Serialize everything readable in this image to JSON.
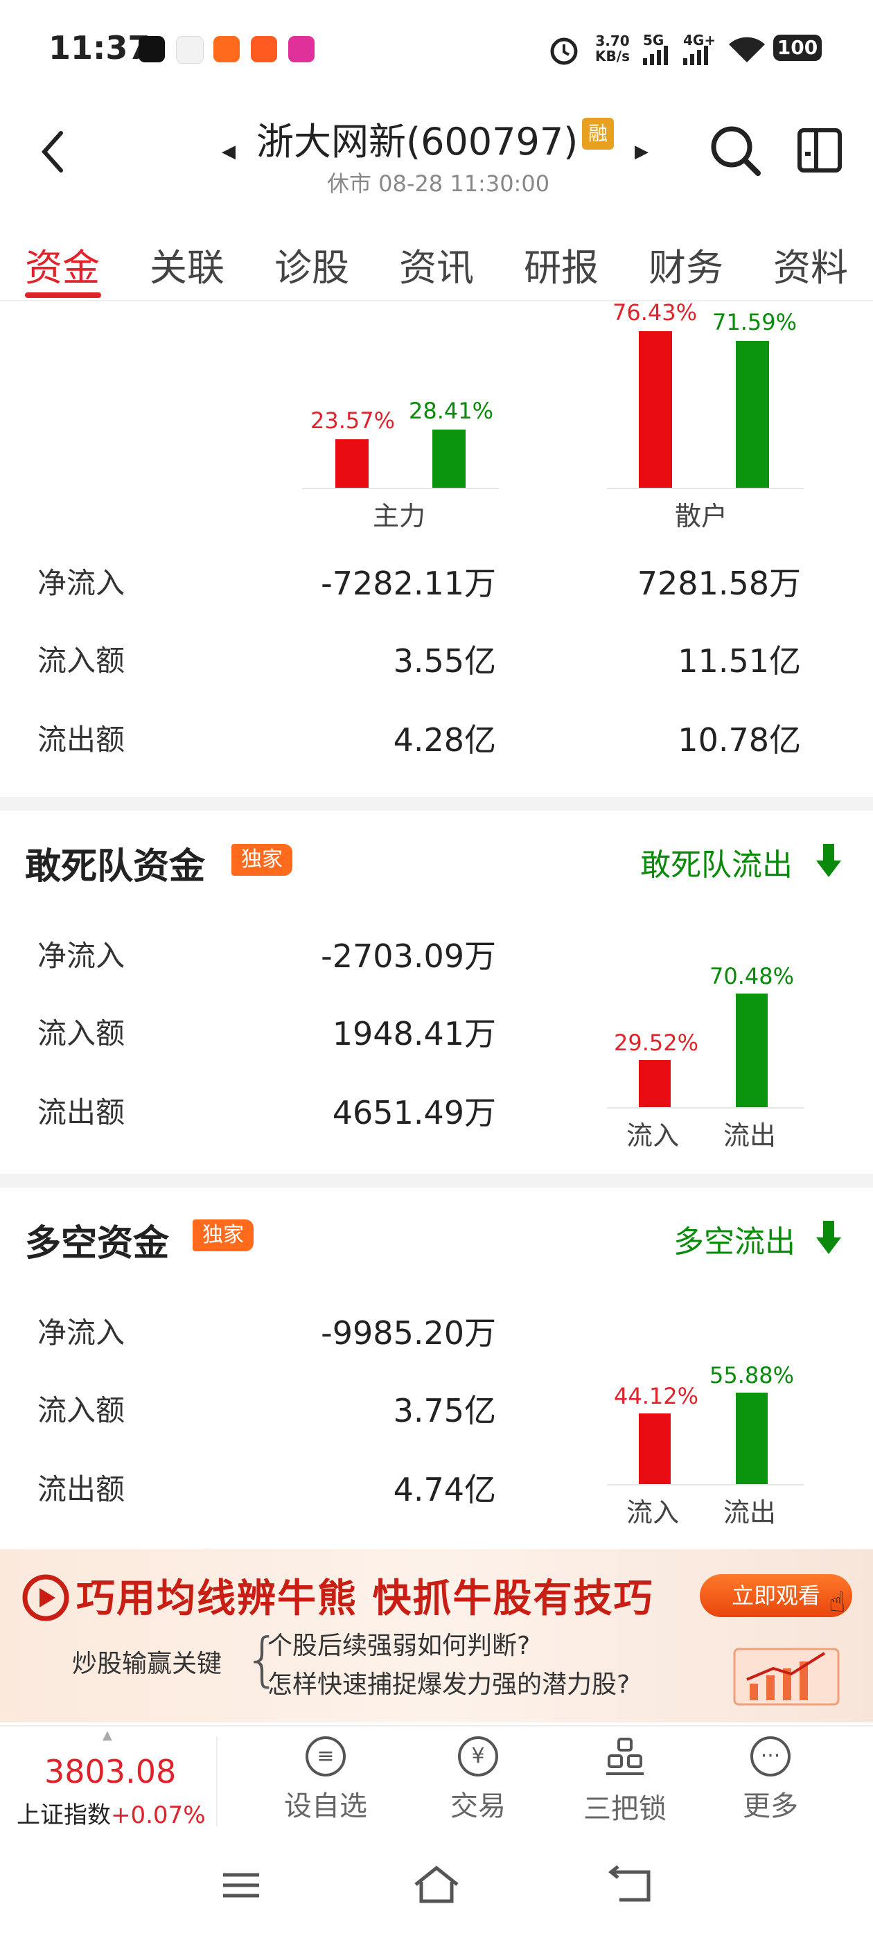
{
  "status_bar": {
    "time": "11:37",
    "speed": "3.70\nKB/s",
    "net1": "5G",
    "net2": "4G+",
    "battery": "100"
  },
  "header": {
    "title": "浙大网新(600797)",
    "rong_badge": "融",
    "subtitle": "休市 08-28 11:30:00"
  },
  "tabs": [
    "资金",
    "关联",
    "诊股",
    "资讯",
    "研报",
    "财务",
    "资料"
  ],
  "distribution": {
    "groups": [
      {
        "label": "主力",
        "inflow_pct": "23.57%",
        "outflow_pct": "28.41%"
      },
      {
        "label": "散户",
        "inflow_pct": "76.43%",
        "outflow_pct": "71.59%"
      }
    ],
    "rows": [
      {
        "label": "净流入",
        "main": "-7282.11万",
        "retail": "7281.58万"
      },
      {
        "label": "流入额",
        "main": "3.55亿",
        "retail": "11.51亿"
      },
      {
        "label": "流出额",
        "main": "4.28亿",
        "retail": "10.78亿"
      }
    ]
  },
  "dare_fund": {
    "title": "敢死队资金",
    "badge": "独家",
    "link": "敢死队流出",
    "rows": [
      {
        "label": "净流入",
        "value": "-2703.09万"
      },
      {
        "label": "流入额",
        "value": "1948.41万"
      },
      {
        "label": "流出额",
        "value": "4651.49万"
      }
    ],
    "chart": {
      "in_pct": "29.52%",
      "out_pct": "70.48%",
      "in_label": "流入",
      "out_label": "流出"
    }
  },
  "longshort_fund": {
    "title": "多空资金",
    "badge": "独家",
    "link": "多空流出",
    "rows": [
      {
        "label": "净流入",
        "value": "-9985.20万"
      },
      {
        "label": "流入额",
        "value": "3.75亿"
      },
      {
        "label": "流出额",
        "value": "4.74亿"
      }
    ],
    "chart": {
      "in_pct": "44.12%",
      "out_pct": "55.88%",
      "in_label": "流入",
      "out_label": "流出"
    }
  },
  "banner": {
    "headline": "巧用均线辨牛熊  快抓牛股有技巧",
    "button": "立即观看",
    "left_text": "炒股输赢关键",
    "line1": "个股后续强弱如何判断?",
    "line2": "怎样快速捕捉爆发力强的潜力股?"
  },
  "bottom": {
    "index_value": "3803.08",
    "index_name": "上证指数",
    "index_change": "+0.07%",
    "nav": [
      {
        "label": "设自选",
        "icon": "list-circle-icon"
      },
      {
        "label": "交易",
        "icon": "yen-circle-icon"
      },
      {
        "label": "三把锁",
        "icon": "lock-group-icon"
      },
      {
        "label": "更多",
        "icon": "more-dots-icon"
      }
    ]
  },
  "colors": {
    "accent_red": "#e0222a",
    "bar_red": "#e80c12",
    "bar_green": "#0b950e",
    "text_green": "#0a8a0a"
  }
}
